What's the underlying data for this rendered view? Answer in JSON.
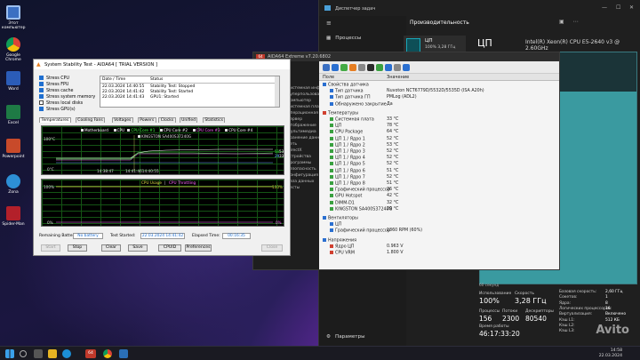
{
  "desktop": {
    "icons": [
      "Этот компьютер",
      "Google Chrome",
      "Word",
      "Excel",
      "Powerpoint",
      "Zona",
      "Spider-Man"
    ]
  },
  "taskmgr": {
    "title": "Диспетчер задач",
    "nav": [
      "Процессы",
      "Производительность",
      "Параметры"
    ],
    "header": "Производительность",
    "tile_label": "ЦП",
    "tile_value": "100%  3,28 ГГц",
    "cpu_big": "ЦП",
    "cpu_model": "Intel(R) Xeon(R) CPU E5-2640 v3 @ 2.60GHz",
    "graph_label": "60 секунд",
    "stats": {
      "util_label": "Использование",
      "util_value": "100%",
      "speed_label": "Скорость",
      "speed_value": "3,28 ГГц",
      "proc_label": "Процессы",
      "threads_label": "Потоки",
      "handles_label": "Дескрипторы",
      "proc": "156",
      "threads": "2300",
      "handles": "80540",
      "uptime_label": "Время работы",
      "uptime": "46:17:33:20",
      "right": [
        [
          "Базовая скорость:",
          "2,60 ГГц"
        ],
        [
          "Сокетов:",
          "1"
        ],
        [
          "Ядра:",
          "8"
        ],
        [
          "Логических процессоров:",
          "16"
        ],
        [
          "Виртуализация:",
          "Включено"
        ],
        [
          "Кэш L1:",
          "512 КБ"
        ],
        [
          "Кэш L2:",
          ""
        ],
        [
          "Кэш L3:",
          ""
        ]
      ]
    }
  },
  "aida": {
    "title": "AIDA64 Extreme v7.20.6802",
    "badge": "64",
    "left": [
      "Системная информа...",
      "Суперпользовательский ПК",
      "Компьютер",
      "Системная плата",
      "Операционная система",
      "Сервер",
      "Отображение",
      "Мультимедиа",
      "Хранение данных",
      "Сеть",
      "DirectX",
      "Устройства",
      "Программы",
      "Безопасность",
      "Конфигурация",
      "База данных",
      "Тесты"
    ],
    "col_field": "Поле",
    "col_value": "Значение",
    "rows": [
      {
        "t": "h",
        "f": "Свойства датчика",
        "c": "#2a6fd0"
      },
      {
        "t": "r",
        "f": "Тип датчика",
        "v": "Nuvoton NCT6779D/5532D/5535D  (ISA A20h)",
        "c": "#2a6fd0"
      },
      {
        "t": "r",
        "f": "Тип датчика ГП",
        "v": "PMLog  (ADL2)",
        "c": "#2a6fd0"
      },
      {
        "t": "r",
        "f": "Обнаружено закрытие",
        "v": "Да",
        "c": "#2a6fd0"
      },
      {
        "t": "s"
      },
      {
        "t": "h",
        "f": "Температуры",
        "c": "#d04030"
      },
      {
        "t": "r",
        "f": "Системная плата",
        "v": "33 °C",
        "c": "#3aa040"
      },
      {
        "t": "r",
        "f": "ЦП",
        "v": "78 °C",
        "c": "#3aa040"
      },
      {
        "t": "r",
        "f": "CPU Package",
        "v": "64 °C",
        "c": "#3aa040"
      },
      {
        "t": "r",
        "f": "ЦП 1 / Ядро 1",
        "v": "52 °C",
        "c": "#3aa040"
      },
      {
        "t": "r",
        "f": "ЦП 1 / Ядро 2",
        "v": "53 °C",
        "c": "#3aa040"
      },
      {
        "t": "r",
        "f": "ЦП 1 / Ядро 3",
        "v": "52 °C",
        "c": "#3aa040"
      },
      {
        "t": "r",
        "f": "ЦП 1 / Ядро 4",
        "v": "52 °C",
        "c": "#3aa040"
      },
      {
        "t": "r",
        "f": "ЦП 1 / Ядро 5",
        "v": "52 °C",
        "c": "#3aa040"
      },
      {
        "t": "r",
        "f": "ЦП 1 / Ядро 6",
        "v": "51 °C",
        "c": "#3aa040"
      },
      {
        "t": "r",
        "f": "ЦП 1 / Ядро 7",
        "v": "52 °C",
        "c": "#3aa040"
      },
      {
        "t": "r",
        "f": "ЦП 1 / Ядро 8",
        "v": "51 °C",
        "c": "#3aa040"
      },
      {
        "t": "r",
        "f": "Графический процессор",
        "v": "36 °C",
        "c": "#3aa040"
      },
      {
        "t": "r",
        "f": "GPU Hotspot",
        "v": "42 °C",
        "c": "#3aa040"
      },
      {
        "t": "r",
        "f": "DIMM-D1",
        "v": "32 °C",
        "c": "#3aa040"
      },
      {
        "t": "r",
        "f": "KINGSTON SA400S37240G",
        "v": "29 °C",
        "c": "#3aa040"
      },
      {
        "t": "s"
      },
      {
        "t": "h",
        "f": "Вентиляторы",
        "c": "#2a6fd0"
      },
      {
        "t": "r",
        "f": "ЦП",
        "v": "",
        "c": "#2a6fd0"
      },
      {
        "t": "r",
        "f": "Графический процессор",
        "v": "1860 RPM  (60%)",
        "c": "#2a6fd0"
      },
      {
        "t": "s"
      },
      {
        "t": "h",
        "f": "Напряжения",
        "c": "#2a6fd0"
      },
      {
        "t": "r",
        "f": "Ядро ЦП",
        "v": "0.963 V",
        "c": "#d04030"
      },
      {
        "t": "r",
        "f": "CPU VRM",
        "v": "1.800 V",
        "c": "#d04030"
      }
    ]
  },
  "sst": {
    "title": "System Stability Test - AIDA64  [ TRIAL VERSION ]",
    "checks": [
      {
        "l": "Stress CPU",
        "on": true
      },
      {
        "l": "Stress FPU",
        "on": true
      },
      {
        "l": "Stress cache",
        "on": true
      },
      {
        "l": "Stress system memory",
        "on": true
      },
      {
        "l": "Stress local disks",
        "on": false
      },
      {
        "l": "Stress GPU(s)",
        "on": true
      }
    ],
    "log_head_date": "Date / Time",
    "log_head_status": "Status",
    "log": [
      [
        "22.03.2024 14:40:55",
        "Stability Test: Stopped"
      ],
      [
        "22.03.2024 14:41:42",
        "Stability Test: Started"
      ],
      [
        "22.03.2024 14:41:43",
        "GPU1: Started"
      ]
    ],
    "tabs": [
      "Temperatures",
      "Cooling Fans",
      "Voltages",
      "Powers",
      "Clocks",
      "Unified",
      "Statistics"
    ],
    "legend": [
      {
        "l": "Motherboard",
        "c": "#ffffff"
      },
      {
        "l": "CPU",
        "c": "#ffffff"
      },
      {
        "l": "CPU Core #1",
        "c": "#44ff44"
      },
      {
        "l": "CPU Core #2",
        "c": "#ffffff"
      },
      {
        "l": "CPU Core #3",
        "c": "#ff66ff"
      },
      {
        "l": "CPU Core #4",
        "c": "#ffffff"
      }
    ],
    "legend2": "KINGSTON SA400S37240G",
    "g1_top": "100°C",
    "g1_bot": "0°C",
    "t1": "14:38:47",
    "t2": "14:41:4614:40:55",
    "rv1": "51",
    "rv2": "53",
    "rv3": "29",
    "rv4": "33",
    "g2_title_a": "CPU Usage",
    "g2_title_sep": "|",
    "g2_title_b": "CPU Throttling",
    "g2_top": "100%",
    "g2_bot": "0%",
    "g2_r1": "100%",
    "g2_r2": "0%",
    "batt_label": "Remaining Battery:",
    "batt": "No battery",
    "start_label": "Test Started:",
    "start": "22.03.2024 14:41:42",
    "elapsed_label": "Elapsed Time:",
    "elapsed": "00:16:35",
    "buttons": [
      "Start",
      "Stop",
      "Clear",
      "Save",
      "CPUID",
      "Preferences",
      "Close"
    ]
  },
  "taskbar": {
    "time": "14:58",
    "date": "22.03.2024",
    "badge": "64"
  },
  "watermark": "Avito",
  "colors": {
    "accent": "#19a7b8",
    "graph_green": "#44ff44",
    "ai_red": "#c0392b"
  }
}
